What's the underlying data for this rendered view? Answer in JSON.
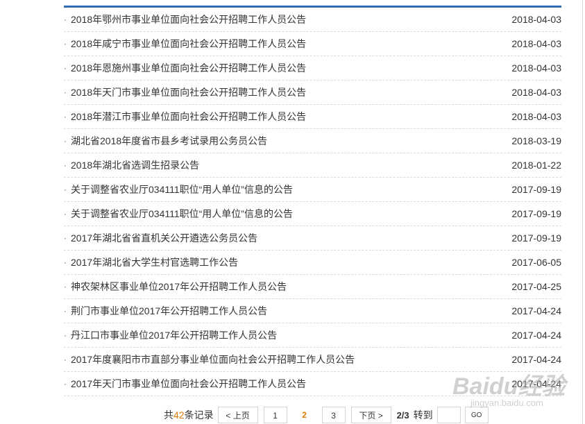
{
  "list": {
    "items": [
      {
        "title": "2018年鄂州市事业单位面向社会公开招聘工作人员公告",
        "date": "2018-04-03"
      },
      {
        "title": "2018年咸宁市事业单位面向社会公开招聘工作人员公告",
        "date": "2018-04-03"
      },
      {
        "title": "2018年恩施州事业单位面向社会公开招聘工作人员公告",
        "date": "2018-04-03"
      },
      {
        "title": "2018年天门市事业单位面向社会公开招聘工作人员公告",
        "date": "2018-04-03"
      },
      {
        "title": "2018年潜江市事业单位面向社会公开招聘工作人员公告",
        "date": "2018-04-03"
      },
      {
        "title": "湖北省2018年度省市县乡考试录用公务员公告",
        "date": "2018-03-19"
      },
      {
        "title": "2018年湖北省选调生招录公告",
        "date": "2018-01-22"
      },
      {
        "title": "关于调整省农业厅034111职位“用人单位”信息的公告",
        "date": "2017-09-19"
      },
      {
        "title": "关于调整省农业厅034111职位“用人单位”信息的公告",
        "date": "2017-09-19"
      },
      {
        "title": "2017年湖北省省直机关公开遴选公务员公告",
        "date": "2017-09-19"
      },
      {
        "title": "2017年湖北省大学生村官选聘工作公告",
        "date": "2017-06-05"
      },
      {
        "title": "神农架林区事业单位2017年公开招聘工作人员公告",
        "date": "2017-04-25"
      },
      {
        "title": "荆门市事业单位2017年公开招聘工作人员公告",
        "date": "2017-04-24"
      },
      {
        "title": "丹江口市事业单位2017年公开招聘工作人员公告",
        "date": "2017-04-24"
      },
      {
        "title": "2017年度襄阳市市直部分事业单位面向社会公开招聘工作人员公告",
        "date": "2017-04-24"
      },
      {
        "title": "2017年天门市事业单位面向社会公开招聘工作人员公告",
        "date": "2017-04-24"
      }
    ],
    "bullet": "·"
  },
  "pager": {
    "total_prefix": "共",
    "total_count": "42",
    "total_suffix": "条记录",
    "prev_label": "< 上页",
    "pages": [
      "1",
      "2",
      "3"
    ],
    "current_page": "2",
    "next_label": "下页 >",
    "page_info": "2/3",
    "goto_label": "转到",
    "go_label": "GO"
  },
  "watermark": {
    "text": "Baidu经验",
    "sub": "jingyan.baidu.com"
  },
  "colors": {
    "accent_blue": "#2f6ab7",
    "highlight_orange": "#e07b00"
  }
}
